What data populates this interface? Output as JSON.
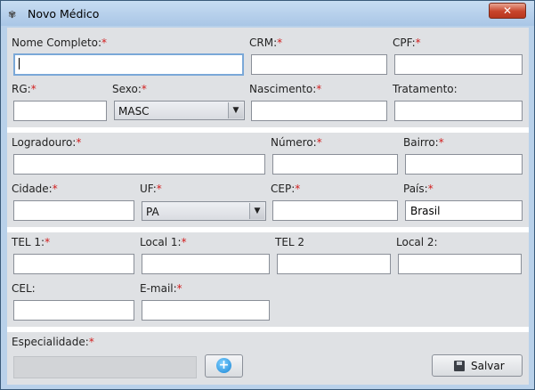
{
  "window": {
    "title": "Novo Médico",
    "app_icon": "caduceus-icon",
    "close_icon": "close-icon",
    "close_glyph": "✕"
  },
  "form": {
    "nome": {
      "label": "Nome Completo:",
      "required": "*",
      "value": ""
    },
    "crm": {
      "label": "CRM:",
      "required": "*",
      "value": ""
    },
    "cpf": {
      "label": "CPF:",
      "required": "*",
      "value": ""
    },
    "rg": {
      "label": "RG:",
      "required": "*",
      "value": ""
    },
    "sexo": {
      "label": "Sexo:",
      "required": "*",
      "selected": "MASC"
    },
    "nascimento": {
      "label": "Nascimento:",
      "required": "*",
      "value": ""
    },
    "tratamento": {
      "label": "Tratamento:",
      "value": ""
    },
    "logradouro": {
      "label": "Logradouro:",
      "required": "*",
      "value": ""
    },
    "numero": {
      "label": "Número:",
      "required": "*",
      "value": ""
    },
    "bairro": {
      "label": "Bairro:",
      "required": "*",
      "value": ""
    },
    "cidade": {
      "label": "Cidade:",
      "required": "*",
      "value": ""
    },
    "uf": {
      "label": "UF:",
      "required": "*",
      "selected": "PA"
    },
    "cep": {
      "label": "CEP:",
      "required": "*",
      "value": ""
    },
    "pais": {
      "label": "País:",
      "required": "*",
      "value": "Brasil"
    },
    "tel1": {
      "label": "TEL 1:",
      "required": "*",
      "value": ""
    },
    "local1": {
      "label": "Local 1:",
      "required": "*",
      "value": ""
    },
    "tel2": {
      "label": "TEL 2",
      "value": ""
    },
    "local2": {
      "label": "Local 2:",
      "value": ""
    },
    "cel": {
      "label": "CEL:",
      "value": ""
    },
    "email": {
      "label": "E-mail:",
      "required": "*",
      "value": ""
    },
    "especialidade": {
      "label": "Especialidade:",
      "required": "*",
      "value": ""
    }
  },
  "buttons": {
    "add_icon": "plus-circle-icon",
    "add_glyph": "+",
    "save_icon": "floppy-disk-icon",
    "save_label": "Salvar"
  },
  "dropdown_arrow": "▼"
}
